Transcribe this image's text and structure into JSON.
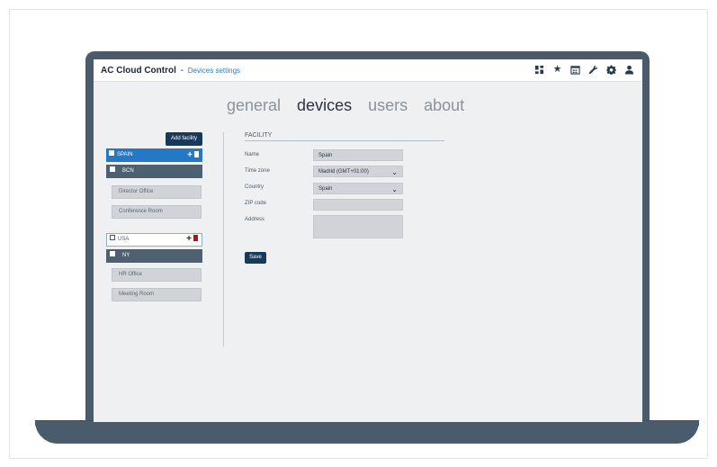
{
  "header": {
    "app_name": "AC Cloud Control",
    "separator": "-",
    "page_name": "Devices settings",
    "icons": [
      "dashboard-icon",
      "star-icon",
      "calendar-icon",
      "wrench-icon",
      "gear-icon",
      "user-icon"
    ]
  },
  "tabs": [
    {
      "label": "general",
      "active": false
    },
    {
      "label": "devices",
      "active": true
    },
    {
      "label": "users",
      "active": false
    },
    {
      "label": "about",
      "active": false
    }
  ],
  "sidebar": {
    "add_facility_label": "Add facility",
    "facilities": [
      {
        "name": "SPAIN",
        "selected": true,
        "cities": [
          {
            "name": "BCN",
            "rooms": [
              "Director Office",
              "Conference Room"
            ]
          }
        ]
      },
      {
        "name": "USA",
        "selected": false,
        "cities": [
          {
            "name": "NY",
            "rooms": [
              "HR Office",
              "Meeting Room"
            ]
          }
        ]
      }
    ]
  },
  "form": {
    "section_title": "FACILITY",
    "name_label": "Name",
    "name_value": "Spain",
    "timezone_label": "Time zone",
    "timezone_value": "Madrid (GMT+01:00)",
    "country_label": "Country",
    "country_value": "Spain",
    "zip_label": "ZIP code",
    "zip_value": "",
    "address_label": "Address",
    "address_value": "",
    "save_label": "Save"
  },
  "colors": {
    "laptop_body": "#4a5b6b",
    "accent_blue": "#2478c5",
    "dark_button": "#17395a",
    "delete_red": "#b0141a"
  }
}
